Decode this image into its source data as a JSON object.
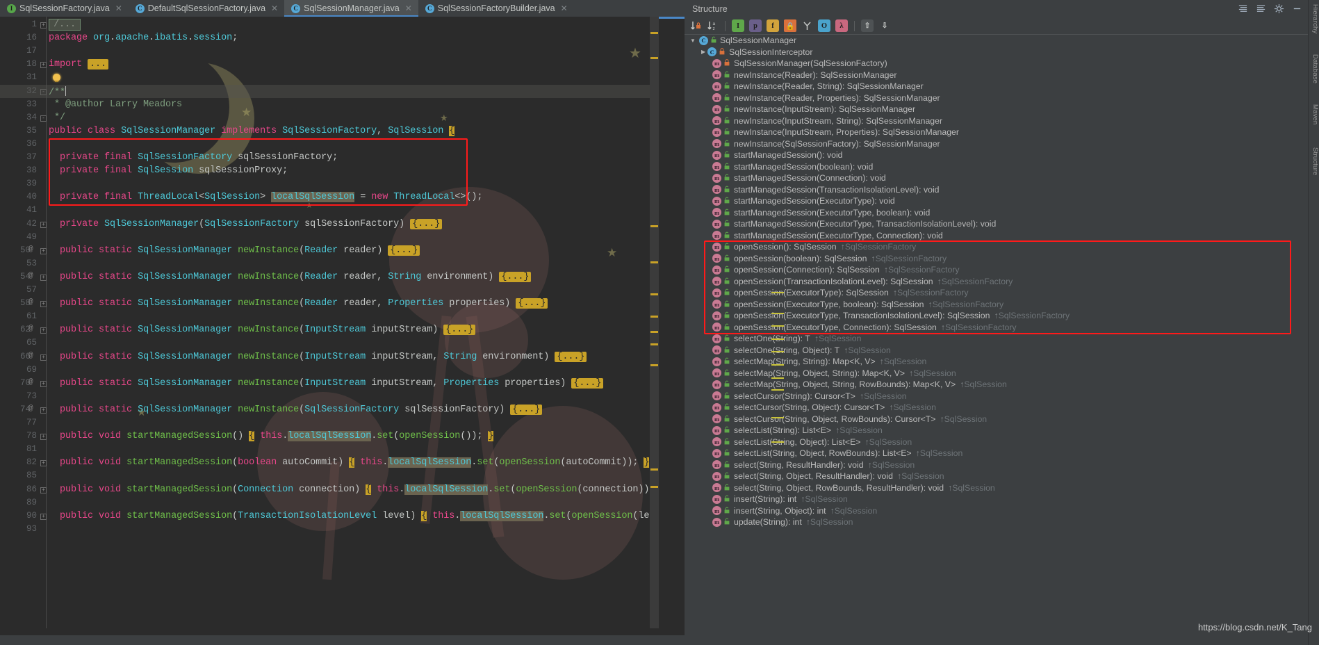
{
  "tabs": [
    {
      "label": "SqlSessionFactory.java",
      "icon": "interface-icon",
      "kind": "I",
      "active": false
    },
    {
      "label": "DefaultSqlSessionFactory.java",
      "icon": "class-icon",
      "kind": "C",
      "active": false
    },
    {
      "label": "SqlSessionManager.java",
      "icon": "class-icon",
      "kind": "C",
      "active": true
    },
    {
      "label": "SqlSessionFactoryBuilder.java",
      "icon": "class-icon",
      "kind": "C",
      "active": false
    }
  ],
  "editor": {
    "lines": [
      {
        "n": "1",
        "marks": "",
        "fold": "+",
        "content": "fold_ellipsis"
      },
      {
        "n": "16",
        "marks": "",
        "fold": "",
        "content": "package org.apache.ibatis.session;"
      },
      {
        "n": "17",
        "marks": "",
        "fold": "",
        "content": ""
      },
      {
        "n": "18",
        "marks": "",
        "fold": "+",
        "content": "import ..."
      },
      {
        "n": "31",
        "marks": "",
        "fold": "",
        "content": "bulb"
      },
      {
        "n": "32",
        "marks": "",
        "fold": "-",
        "content": "/**",
        "current": true
      },
      {
        "n": "33",
        "marks": "",
        "fold": "",
        "content": " * @author Larry Meadors"
      },
      {
        "n": "34",
        "marks": "",
        "fold": "-",
        "content": " */"
      },
      {
        "n": "35",
        "marks": "",
        "fold": "",
        "content": "public class SqlSessionManager implements SqlSessionFactory, SqlSession {"
      },
      {
        "n": "36",
        "marks": "",
        "fold": "",
        "content": ""
      },
      {
        "n": "37",
        "marks": "",
        "fold": "",
        "content": "  private final SqlSessionFactory sqlSessionFactory;"
      },
      {
        "n": "38",
        "marks": "",
        "fold": "",
        "content": "  private final SqlSession sqlSessionProxy;"
      },
      {
        "n": "39",
        "marks": "",
        "fold": "",
        "content": ""
      },
      {
        "n": "40",
        "marks": "",
        "fold": "",
        "content": "  private final ThreadLocal<SqlSession> localSqlSession = new ThreadLocal<>();"
      },
      {
        "n": "41",
        "marks": "",
        "fold": "",
        "content": ""
      },
      {
        "n": "42",
        "marks": "",
        "fold": "+",
        "content": "  private SqlSessionManager(SqlSessionFactory sqlSessionFactory) {...}"
      },
      {
        "n": "49",
        "marks": "",
        "fold": "",
        "content": ""
      },
      {
        "n": "50",
        "marks": "@",
        "fold": "+",
        "content": "  public static SqlSessionManager newInstance(Reader reader) {...}"
      },
      {
        "n": "53",
        "marks": "",
        "fold": "",
        "content": ""
      },
      {
        "n": "54",
        "marks": "@",
        "fold": "+",
        "content": "  public static SqlSessionManager newInstance(Reader reader, String environment) {...}"
      },
      {
        "n": "57",
        "marks": "",
        "fold": "",
        "content": ""
      },
      {
        "n": "58",
        "marks": "@",
        "fold": "+",
        "content": "  public static SqlSessionManager newInstance(Reader reader, Properties properties) {...}"
      },
      {
        "n": "61",
        "marks": "",
        "fold": "",
        "content": ""
      },
      {
        "n": "62",
        "marks": "@",
        "fold": "+",
        "content": "  public static SqlSessionManager newInstance(InputStream inputStream) {...}"
      },
      {
        "n": "65",
        "marks": "",
        "fold": "",
        "content": ""
      },
      {
        "n": "66",
        "marks": "@",
        "fold": "+",
        "content": "  public static SqlSessionManager newInstance(InputStream inputStream, String environment) {...}"
      },
      {
        "n": "69",
        "marks": "",
        "fold": "",
        "content": ""
      },
      {
        "n": "70",
        "marks": "@",
        "fold": "+",
        "content": "  public static SqlSessionManager newInstance(InputStream inputStream, Properties properties) {...}"
      },
      {
        "n": "73",
        "marks": "",
        "fold": "",
        "content": ""
      },
      {
        "n": "74",
        "marks": "@",
        "fold": "+",
        "content": "  public static SqlSessionManager newInstance(SqlSessionFactory sqlSessionFactory) {...}"
      },
      {
        "n": "77",
        "marks": "",
        "fold": "",
        "content": ""
      },
      {
        "n": "78",
        "marks": "",
        "fold": "+",
        "content": "  public void startManagedSession() { this.localSqlSession.set(openSession()); }"
      },
      {
        "n": "81",
        "marks": "",
        "fold": "",
        "content": ""
      },
      {
        "n": "82",
        "marks": "",
        "fold": "+",
        "content": "  public void startManagedSession(boolean autoCommit) { this.localSqlSession.set(openSession(autoCommit)); }"
      },
      {
        "n": "85",
        "marks": "",
        "fold": "",
        "content": ""
      },
      {
        "n": "86",
        "marks": "",
        "fold": "+",
        "content": "  public void startManagedSession(Connection connection) { this.localSqlSession.set(openSession(connection)); }"
      },
      {
        "n": "89",
        "marks": "",
        "fold": "",
        "content": ""
      },
      {
        "n": "90",
        "marks": "",
        "fold": "+",
        "content": "  public void startManagedSession(TransactionIsolationLevel level) { this.localSqlSession.set(openSession(level)); }"
      },
      {
        "n": "93",
        "marks": "",
        "fold": "",
        "content": ""
      }
    ],
    "highlight_token": "localSqlSession",
    "red_box_label": "fields-highlight-box"
  },
  "structure": {
    "title": "Structure",
    "toolbar_icons": [
      "sort-by-visibility-icon",
      "sort-alphabetically-icon",
      "show-inherited-icon",
      "show-properties-icon",
      "show-fields-icon",
      "show-non-public-icon",
      "group-by-icon",
      "show-anonymous-icon",
      "show-lambdas-icon",
      "expand-all-icon",
      "collapse-all-icon"
    ],
    "header_icons": [
      "settings-icon",
      "gear-icon",
      "hide-icon",
      "minimize-icon"
    ],
    "root": {
      "label": "SqlSessionManager",
      "icon": "class-icon",
      "visibility": "public",
      "expanded": true
    },
    "nodes": [
      {
        "depth": 1,
        "icon": "class-icon",
        "vis": "private",
        "label": "SqlSessionInterceptor",
        "arrow": "collapsed",
        "from": ""
      },
      {
        "depth": 1,
        "icon": "method-icon",
        "vis": "private",
        "label": "SqlSessionManager(SqlSessionFactory)",
        "from": ""
      },
      {
        "depth": 1,
        "icon": "method-icon",
        "vis": "public-static",
        "label": "newInstance(Reader): SqlSessionManager",
        "from": ""
      },
      {
        "depth": 1,
        "icon": "method-icon",
        "vis": "public-static",
        "label": "newInstance(Reader, String): SqlSessionManager",
        "from": ""
      },
      {
        "depth": 1,
        "icon": "method-icon",
        "vis": "public-static",
        "label": "newInstance(Reader, Properties): SqlSessionManager",
        "from": ""
      },
      {
        "depth": 1,
        "icon": "method-icon",
        "vis": "public-static",
        "label": "newInstance(InputStream): SqlSessionManager",
        "from": ""
      },
      {
        "depth": 1,
        "icon": "method-icon",
        "vis": "public-static",
        "label": "newInstance(InputStream, String): SqlSessionManager",
        "from": ""
      },
      {
        "depth": 1,
        "icon": "method-icon",
        "vis": "public-static",
        "label": "newInstance(InputStream, Properties): SqlSessionManager",
        "from": ""
      },
      {
        "depth": 1,
        "icon": "method-icon",
        "vis": "public-static",
        "label": "newInstance(SqlSessionFactory): SqlSessionManager",
        "from": ""
      },
      {
        "depth": 1,
        "icon": "method-icon",
        "vis": "public",
        "label": "startManagedSession(): void",
        "from": ""
      },
      {
        "depth": 1,
        "icon": "method-icon",
        "vis": "public",
        "label": "startManagedSession(boolean): void",
        "from": ""
      },
      {
        "depth": 1,
        "icon": "method-icon",
        "vis": "public",
        "label": "startManagedSession(Connection): void",
        "from": ""
      },
      {
        "depth": 1,
        "icon": "method-icon",
        "vis": "public",
        "label": "startManagedSession(TransactionIsolationLevel): void",
        "from": ""
      },
      {
        "depth": 1,
        "icon": "method-icon",
        "vis": "public",
        "label": "startManagedSession(ExecutorType): void",
        "from": ""
      },
      {
        "depth": 1,
        "icon": "method-icon",
        "vis": "public",
        "label": "startManagedSession(ExecutorType, boolean): void",
        "from": ""
      },
      {
        "depth": 1,
        "icon": "method-icon",
        "vis": "public",
        "label": "startManagedSession(ExecutorType, TransactionIsolationLevel): void",
        "from": ""
      },
      {
        "depth": 1,
        "icon": "method-icon",
        "vis": "public",
        "label": "startManagedSession(ExecutorType, Connection): void",
        "from": ""
      },
      {
        "depth": 1,
        "icon": "method-icon",
        "vis": "public",
        "label": "openSession(): SqlSession",
        "from": "SqlSessionFactory",
        "boxed": true
      },
      {
        "depth": 1,
        "icon": "method-icon",
        "vis": "public",
        "label": "openSession(boolean): SqlSession",
        "from": "SqlSessionFactory",
        "boxed": true
      },
      {
        "depth": 1,
        "icon": "method-icon",
        "vis": "public",
        "label": "openSession(Connection): SqlSession",
        "from": "SqlSessionFactory",
        "boxed": true
      },
      {
        "depth": 1,
        "icon": "method-icon",
        "vis": "public",
        "label": "openSession(TransactionIsolationLevel): SqlSession",
        "from": "SqlSessionFactory",
        "boxed": true
      },
      {
        "depth": 1,
        "icon": "method-icon",
        "vis": "public",
        "label": "openSession(ExecutorType): SqlSession",
        "from": "SqlSessionFactory",
        "boxed": true
      },
      {
        "depth": 1,
        "icon": "method-icon",
        "vis": "public",
        "label": "openSession(ExecutorType, boolean): SqlSession",
        "from": "SqlSessionFactory",
        "boxed": true
      },
      {
        "depth": 1,
        "icon": "method-icon",
        "vis": "public",
        "label": "openSession(ExecutorType, TransactionIsolationLevel): SqlSession",
        "from": "SqlSessionFactory",
        "boxed": true
      },
      {
        "depth": 1,
        "icon": "method-icon",
        "vis": "public",
        "label": "openSession(ExecutorType, Connection): SqlSession",
        "from": "SqlSessionFactory",
        "boxed": true
      },
      {
        "depth": 1,
        "icon": "method-icon",
        "vis": "public",
        "label": "selectOne(String): T",
        "from": "SqlSession"
      },
      {
        "depth": 1,
        "icon": "method-icon",
        "vis": "public",
        "label": "selectOne(String, Object): T",
        "from": "SqlSession"
      },
      {
        "depth": 1,
        "icon": "method-icon",
        "vis": "public",
        "label": "selectMap(String, String): Map<K, V>",
        "from": "SqlSession"
      },
      {
        "depth": 1,
        "icon": "method-icon",
        "vis": "public",
        "label": "selectMap(String, Object, String): Map<K, V>",
        "from": "SqlSession"
      },
      {
        "depth": 1,
        "icon": "method-icon",
        "vis": "public",
        "label": "selectMap(String, Object, String, RowBounds): Map<K, V>",
        "from": "SqlSession"
      },
      {
        "depth": 1,
        "icon": "method-icon",
        "vis": "public",
        "label": "selectCursor(String): Cursor<T>",
        "from": "SqlSession"
      },
      {
        "depth": 1,
        "icon": "method-icon",
        "vis": "public",
        "label": "selectCursor(String, Object): Cursor<T>",
        "from": "SqlSession"
      },
      {
        "depth": 1,
        "icon": "method-icon",
        "vis": "public",
        "label": "selectCursor(String, Object, RowBounds): Cursor<T>",
        "from": "SqlSession"
      },
      {
        "depth": 1,
        "icon": "method-icon",
        "vis": "public",
        "label": "selectList(String): List<E>",
        "from": "SqlSession"
      },
      {
        "depth": 1,
        "icon": "method-icon",
        "vis": "public",
        "label": "selectList(String, Object): List<E>",
        "from": "SqlSession"
      },
      {
        "depth": 1,
        "icon": "method-icon",
        "vis": "public",
        "label": "selectList(String, Object, RowBounds): List<E>",
        "from": "SqlSession"
      },
      {
        "depth": 1,
        "icon": "method-icon",
        "vis": "public",
        "label": "select(String, ResultHandler): void",
        "from": "SqlSession"
      },
      {
        "depth": 1,
        "icon": "method-icon",
        "vis": "public",
        "label": "select(String, Object, ResultHandler): void",
        "from": "SqlSession"
      },
      {
        "depth": 1,
        "icon": "method-icon",
        "vis": "public",
        "label": "select(String, Object, RowBounds, ResultHandler): void",
        "from": "SqlSession"
      },
      {
        "depth": 1,
        "icon": "method-icon",
        "vis": "public",
        "label": "insert(String): int",
        "from": "SqlSession"
      },
      {
        "depth": 1,
        "icon": "method-icon",
        "vis": "public",
        "label": "insert(String, Object): int",
        "from": "SqlSession"
      },
      {
        "depth": 1,
        "icon": "method-icon",
        "vis": "public",
        "label": "update(String): int",
        "from": "SqlSession"
      }
    ]
  },
  "right_strip": [
    "Hierarchy",
    "Database",
    "Maven",
    "Structure"
  ],
  "watermark": "https://blog.csdn.net/K_Tang"
}
